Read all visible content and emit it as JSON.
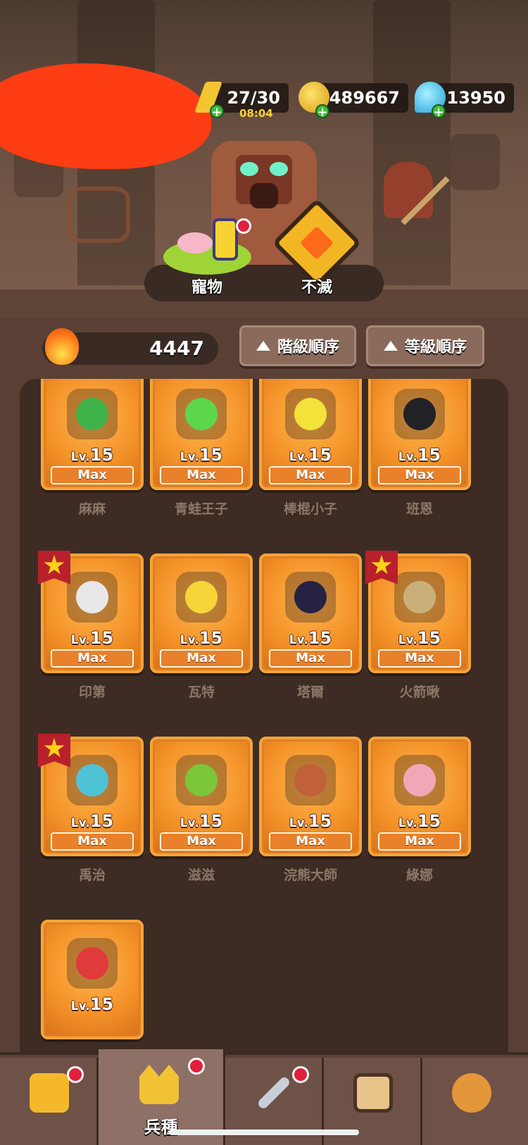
{
  "currency": {
    "energy": "27/30",
    "energy_timer": "08:04",
    "gold": "489667",
    "gems": "13950"
  },
  "menu": {
    "pet_label": "寵物",
    "immortal_label": "不滅"
  },
  "power": "4447",
  "sort": {
    "rank_label": "階級順序",
    "level_label": "等級順序"
  },
  "units": [
    {
      "name": "麻麻",
      "lv_prefix": "Lv.",
      "level": "15",
      "status": "Max",
      "color": "#3fb34a"
    },
    {
      "name": "青蛙王子",
      "lv_prefix": "Lv.",
      "level": "15",
      "status": "Max",
      "color": "#5ed64c"
    },
    {
      "name": "棒棍小子",
      "lv_prefix": "Lv.",
      "level": "15",
      "status": "Max",
      "color": "#f2e23a"
    },
    {
      "name": "班恩",
      "lv_prefix": "Lv.",
      "level": "15",
      "status": "Max",
      "color": "#222226"
    },
    {
      "name": "印第",
      "lv_prefix": "Lv.",
      "level": "15",
      "status": "Max",
      "color": "#e8e8e8",
      "starred": true
    },
    {
      "name": "瓦特",
      "lv_prefix": "Lv.",
      "level": "15",
      "status": "Max",
      "color": "#f5d53a"
    },
    {
      "name": "塔爾",
      "lv_prefix": "Lv.",
      "level": "15",
      "status": "Max",
      "color": "#262342"
    },
    {
      "name": "火箭啾",
      "lv_prefix": "Lv.",
      "level": "15",
      "status": "Max",
      "color": "#c9b07a",
      "starred": true
    },
    {
      "name": "禹治",
      "lv_prefix": "Lv.",
      "level": "15",
      "status": "Max",
      "color": "#4fc3d6",
      "starred": true
    },
    {
      "name": "滋滋",
      "lv_prefix": "Lv.",
      "level": "15",
      "status": "Max",
      "color": "#7cc63a"
    },
    {
      "name": "浣熊大師",
      "lv_prefix": "Lv.",
      "level": "15",
      "status": "Max",
      "color": "#c0613a"
    },
    {
      "name": "綠娜",
      "lv_prefix": "Lv.",
      "level": "15",
      "status": "Max",
      "color": "#f0a8b8"
    },
    {
      "name": "",
      "lv_prefix": "Lv.",
      "level": "15",
      "status": "",
      "color": "#e03a3a"
    }
  ],
  "nav": {
    "active_label": "兵種",
    "tab_icons": [
      "shop-icon",
      "crown-icon",
      "crossed-swords-icon",
      "card-icon",
      "food-icon"
    ]
  }
}
